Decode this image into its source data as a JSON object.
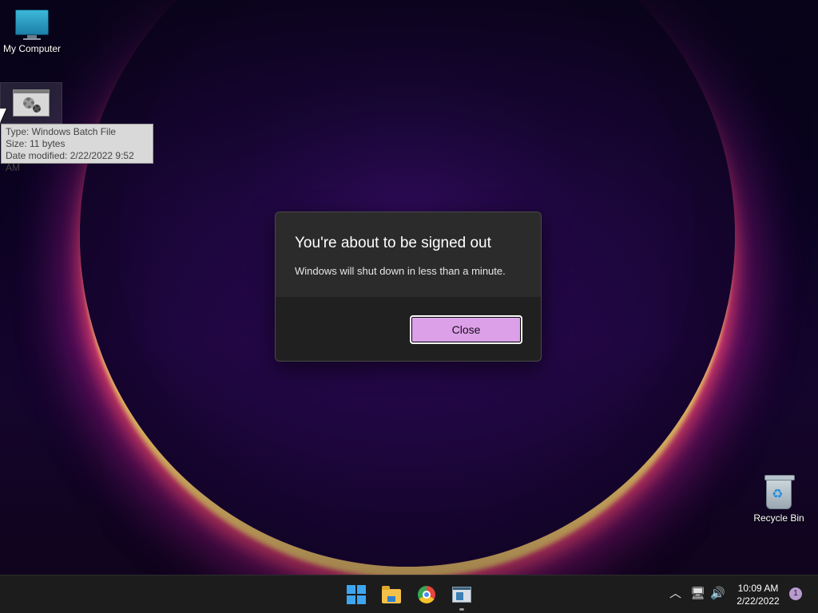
{
  "desktop": {
    "icons": [
      {
        "label": "My Computer",
        "icon": "monitor-icon"
      },
      {
        "label": "",
        "icon": "batch-file-icon"
      },
      {
        "label": "Recycle Bin",
        "icon": "recycle-bin-icon"
      }
    ],
    "tooltip": {
      "type": "Type: Windows Batch File",
      "size": "Size: 11 bytes",
      "modified": "Date modified: 2/22/2022 9:52 AM"
    }
  },
  "dialog": {
    "title": "You're about to be signed out",
    "message": "Windows will shut down in less than a minute.",
    "close_label": "Close",
    "button_color": "#dca0e8"
  },
  "taskbar": {
    "apps": [
      {
        "name": "Start",
        "icon": "windows-start-icon"
      },
      {
        "name": "File Explorer",
        "icon": "folder-icon"
      },
      {
        "name": "Google Chrome",
        "icon": "chrome-icon"
      },
      {
        "name": "App window",
        "icon": "app-window-icon"
      }
    ],
    "tray": {
      "time": "10:09 AM",
      "date": "2/22/2022",
      "notification_count": "1"
    }
  }
}
